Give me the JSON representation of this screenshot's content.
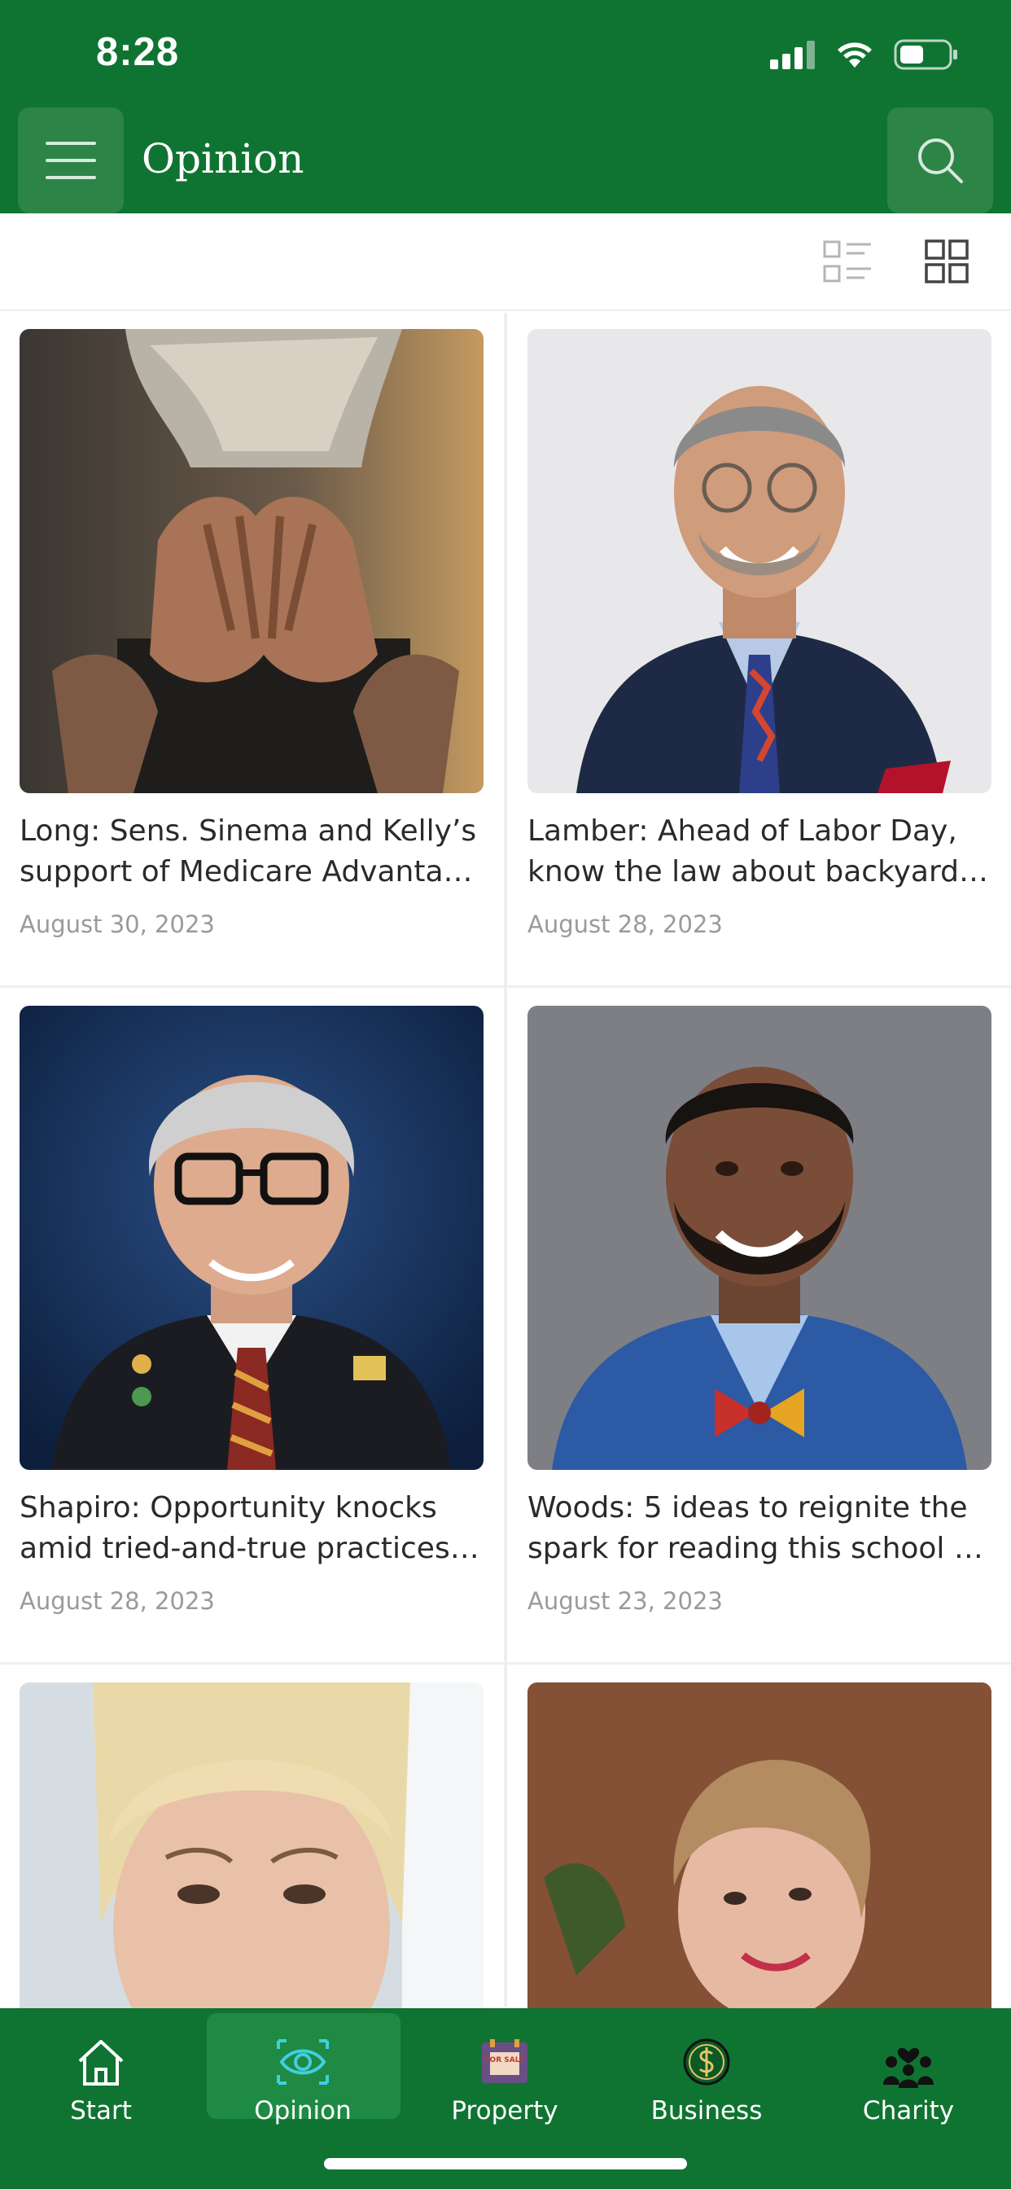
{
  "status_bar": {
    "time": "8:28"
  },
  "header": {
    "title": "Opinion"
  },
  "articles": [
    {
      "title_line1": "Long: Sens. Sinema and Kelly’s",
      "title_line2": "support of Medicare Advantage Plans",
      "date": "August 30, 2023"
    },
    {
      "title_line1": "Lamber: Ahead of Labor Day,",
      "title_line2": "know the law about backyard fires",
      "date": "August 28, 2023"
    },
    {
      "title_line1": "Shapiro: Opportunity knocks",
      "title_line2": "amid tried-and-true practices in",
      "date": "August 28, 2023"
    },
    {
      "title_line1": "Woods: 5 ideas to reignite the",
      "title_line2": "spark for reading this school year",
      "date": "August 23, 2023"
    },
    {
      "title_line1": "",
      "title_line2": "",
      "date": ""
    },
    {
      "title_line1": "",
      "title_line2": "",
      "date": ""
    }
  ],
  "tabs": [
    {
      "label": "Start",
      "icon": "home-icon"
    },
    {
      "label": "Opinion",
      "icon": "eye-icon"
    },
    {
      "label": "Property",
      "icon": "for-sale-sign-icon"
    },
    {
      "label": "Business",
      "icon": "dollar-coin-icon"
    },
    {
      "label": "Charity",
      "icon": "charity-people-icon"
    }
  ],
  "for_sale_sign_text": "FOR SALE",
  "colors": {
    "brand_green": "#0f7432",
    "active_tab": "#1f8a44",
    "eye_icon": "#3fd0e0"
  }
}
